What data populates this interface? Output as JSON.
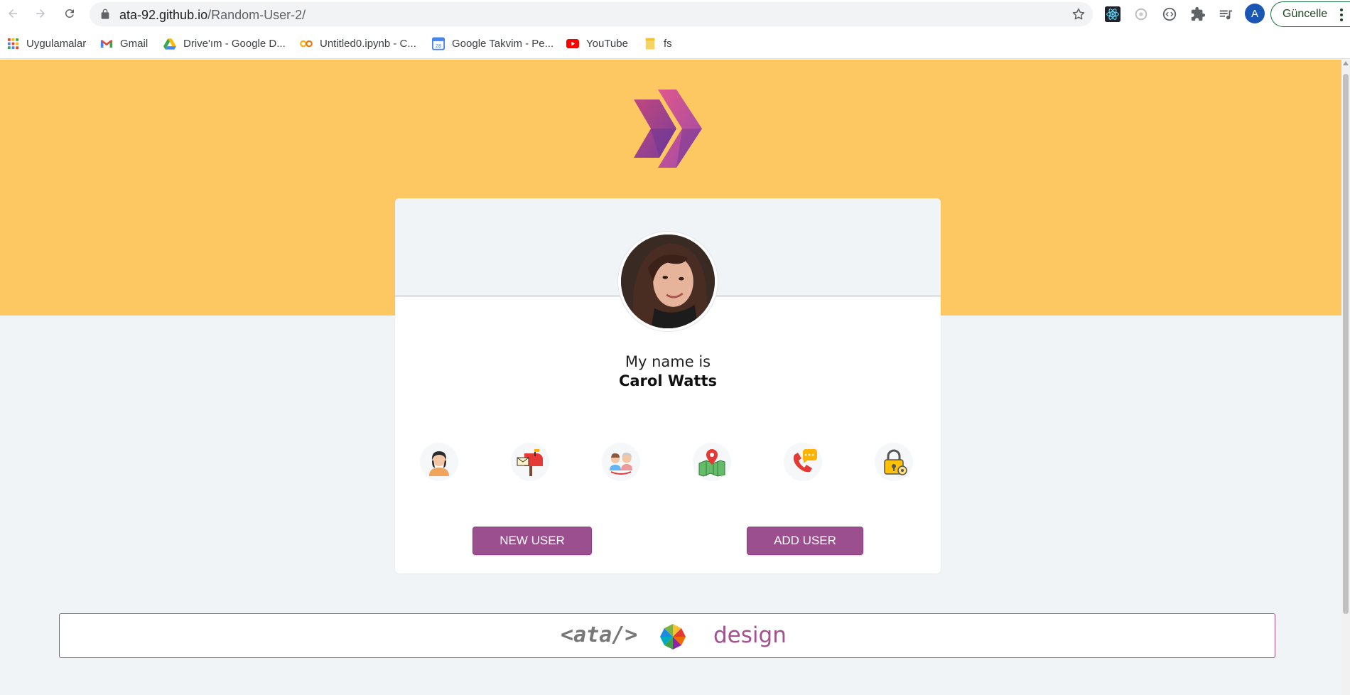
{
  "browser": {
    "url_host": "ata-92.github.io",
    "url_path": "/Random-User-2/",
    "profile_initial": "A",
    "update_label": "Güncelle"
  },
  "bookmarks": [
    {
      "label": "Uygulamalar",
      "icon": "apps-grid-icon"
    },
    {
      "label": "Gmail",
      "icon": "gmail-icon"
    },
    {
      "label": "Drive'ım - Google D...",
      "icon": "google-drive-icon"
    },
    {
      "label": "Untitled0.ipynb - C...",
      "icon": "colab-icon"
    },
    {
      "label": "Google Takvim - Pe...",
      "icon": "calendar-icon"
    },
    {
      "label": "YouTube",
      "icon": "youtube-icon"
    },
    {
      "label": "fs",
      "icon": "folder-icon"
    }
  ],
  "card": {
    "name_label": "My name is",
    "name_value": "Carol Watts",
    "info_icons": [
      "user-icon",
      "mailbox-icon",
      "age-icon",
      "map-icon",
      "phone-icon",
      "lock-icon"
    ]
  },
  "buttons": {
    "new_user": "NEW USER",
    "add_user": "ADD USER"
  },
  "footer": {
    "brand": "<ata/>",
    "design": "design"
  },
  "colors": {
    "hero": "#fdc862",
    "accent": "#9c4f8f",
    "page_bg": "#f1f4f7"
  }
}
